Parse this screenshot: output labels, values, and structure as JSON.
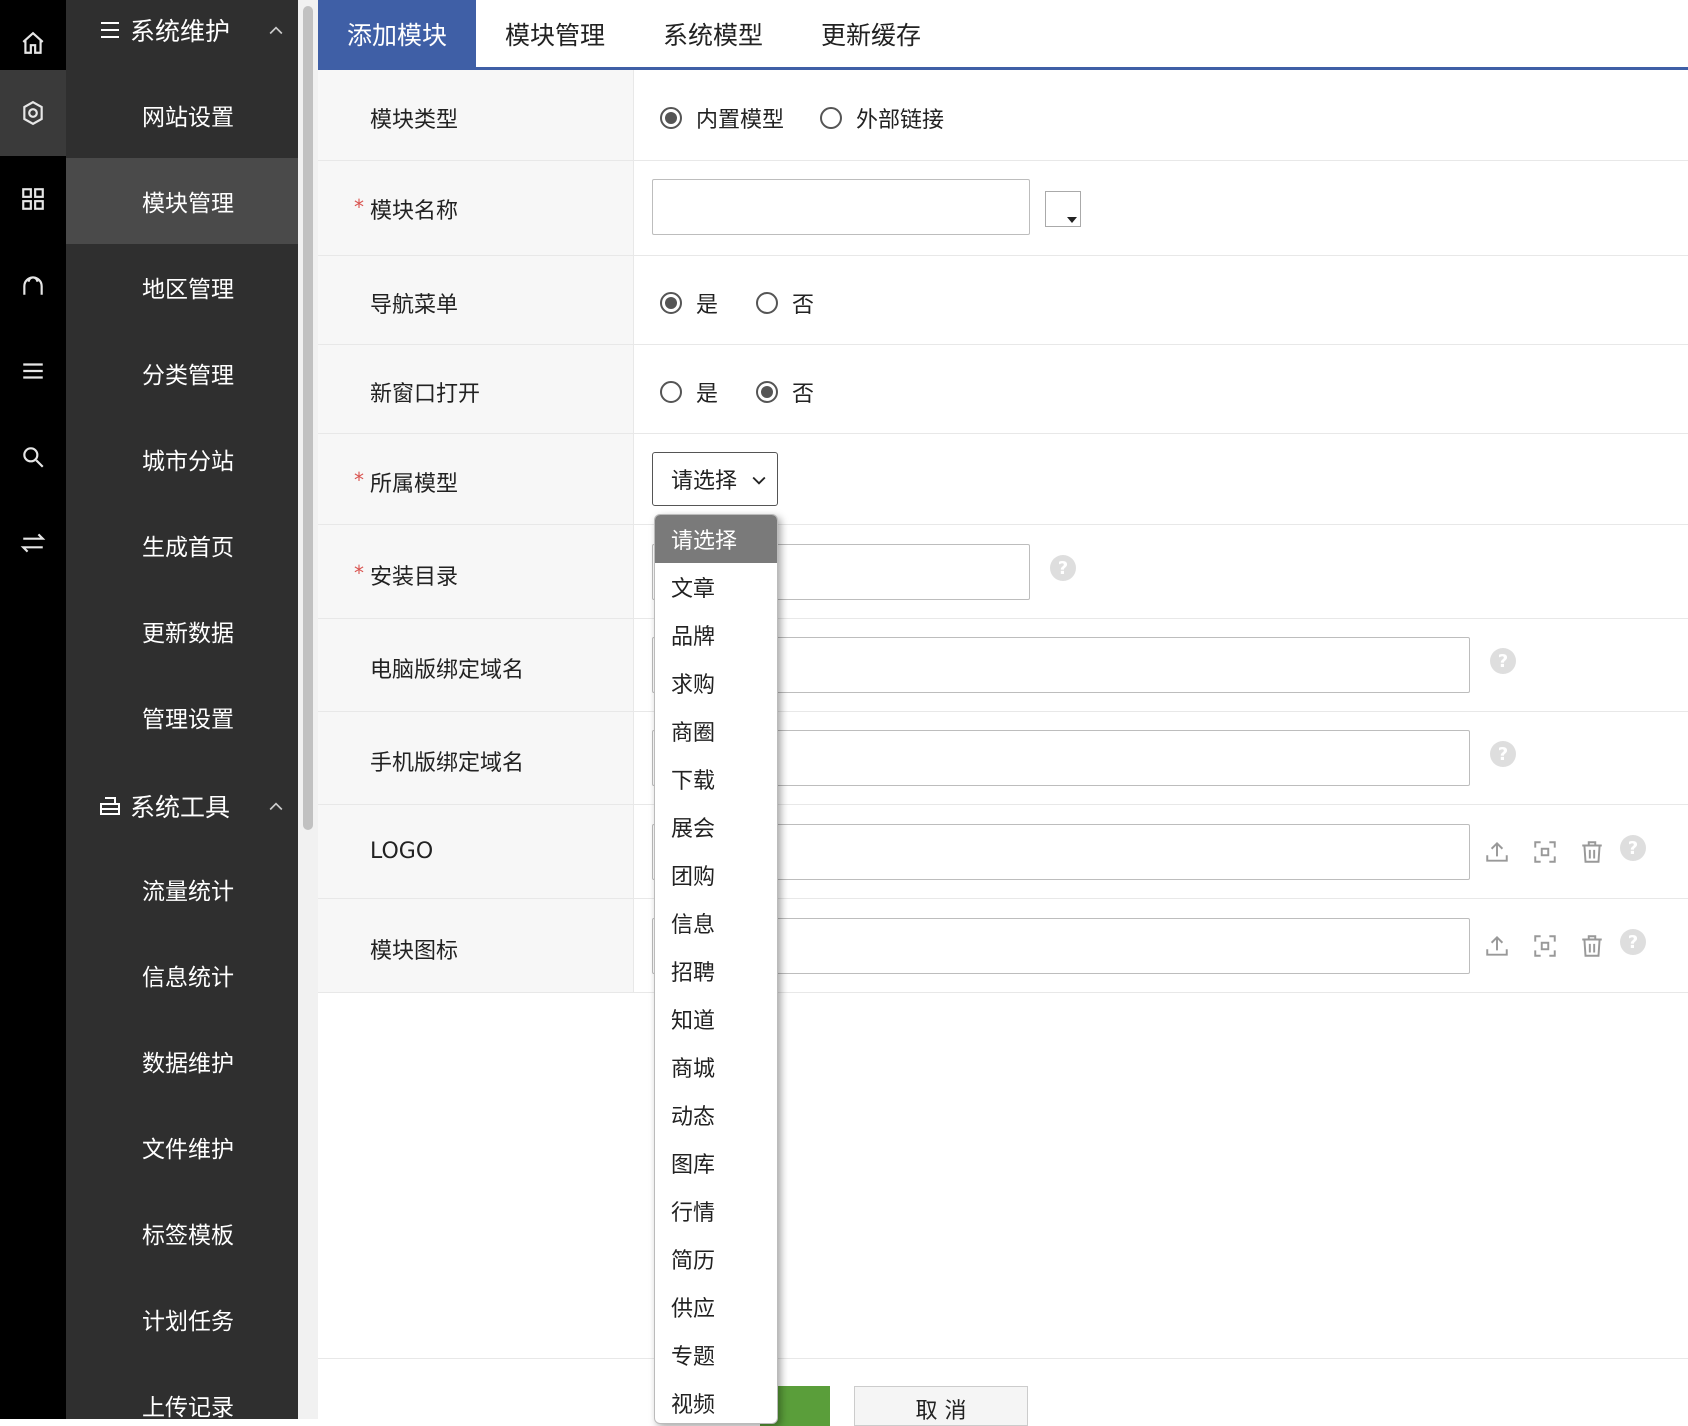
{
  "tabs": [
    "添加模块",
    "模块管理",
    "系统模型",
    "更新缓存"
  ],
  "rail_icons": [
    "home-icon",
    "gear-icon",
    "grid-icon",
    "user-icon",
    "list-icon",
    "search-icon",
    "swap-icon"
  ],
  "nav": {
    "group1": "系统维护",
    "group2": "系统工具",
    "items_a": [
      "网站设置",
      "模块管理",
      "地区管理",
      "分类管理",
      "城市分站",
      "生成首页",
      "更新数据",
      "管理设置"
    ],
    "items_b": [
      "流量统计",
      "信息统计",
      "数据维护",
      "文件维护",
      "标签模板",
      "计划任务",
      "上传记录"
    ]
  },
  "form": {
    "type_label": "模块类型",
    "type_opt1": "内置模型",
    "type_opt2": "外部链接",
    "name_label": "模块名称",
    "navmenu_label": "导航菜单",
    "navmenu_yes": "是",
    "navmenu_no": "否",
    "newwin_label": "新窗口打开",
    "newwin_yes": "是",
    "newwin_no": "否",
    "model_label": "所属模型",
    "model_select": "请选择",
    "dir_label": "安装目录",
    "pc_domain_label": "电脑版绑定域名",
    "mobile_domain_label": "手机版绑定域名",
    "logo_label": "LOGO",
    "icon_label": "模块图标",
    "required_mark": "*",
    "help_mark": "?"
  },
  "dropdown_options": [
    "请选择",
    "文章",
    "品牌",
    "求购",
    "商圈",
    "下载",
    "展会",
    "团购",
    "信息",
    "招聘",
    "知道",
    "商城",
    "动态",
    "图库",
    "行情",
    "简历",
    "供应",
    "专题",
    "视频"
  ],
  "buttons": {
    "cancel": "取 消"
  }
}
